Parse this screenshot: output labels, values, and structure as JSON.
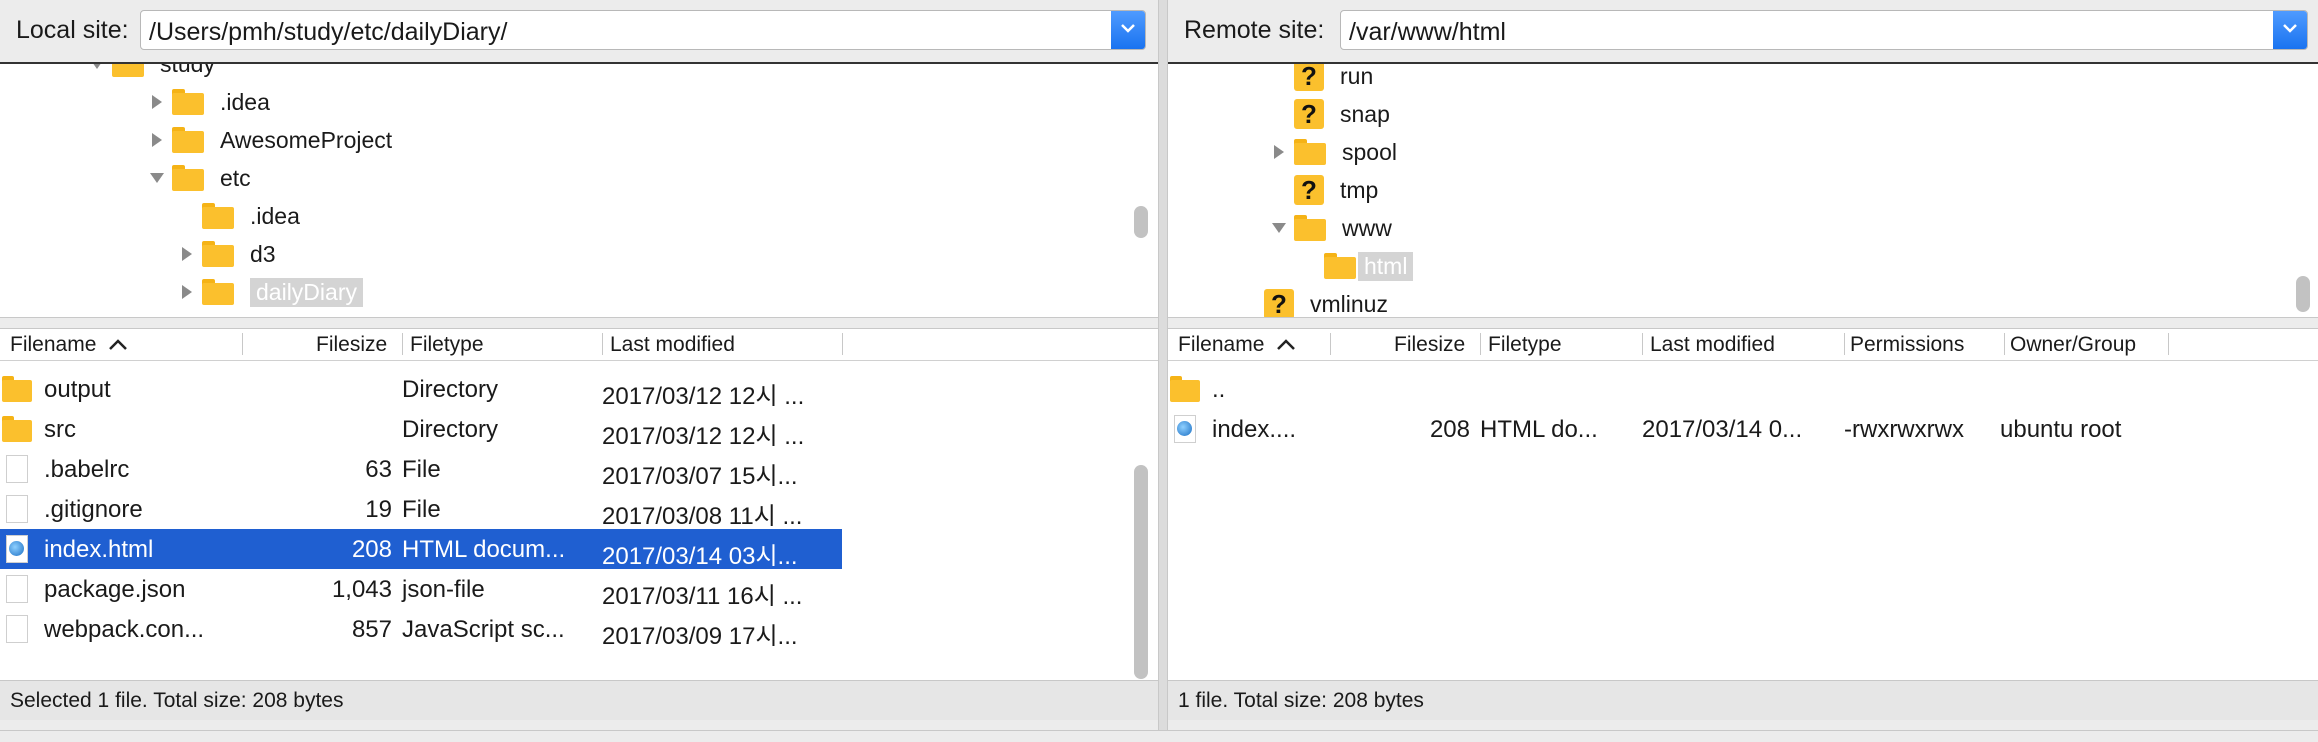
{
  "local": {
    "label": "Local site:",
    "path": "/Users/pmh/study/etc/dailyDiary/",
    "tree": [
      {
        "name": "study"
      },
      {
        "name": ".idea"
      },
      {
        "name": "AwesomeProject"
      },
      {
        "name": "etc"
      },
      {
        "name": ".idea"
      },
      {
        "name": "d3"
      },
      {
        "name": "dailyDiary",
        "selected": true
      }
    ],
    "columns": {
      "filename": "Filename",
      "filesize": "Filesize",
      "filetype": "Filetype",
      "modified": "Last modified"
    },
    "files": [
      {
        "name": "output",
        "size": "",
        "type": "Directory",
        "modified": "2017/03/12 12시 ...",
        "icon": "folder-icon"
      },
      {
        "name": "src",
        "size": "",
        "type": "Directory",
        "modified": "2017/03/12 12시 ...",
        "icon": "folder-icon"
      },
      {
        "name": ".babelrc",
        "size": "63",
        "type": "File",
        "modified": "2017/03/07 15시...",
        "icon": "file-icon"
      },
      {
        "name": ".gitignore",
        "size": "19",
        "type": "File",
        "modified": "2017/03/08 11시 ...",
        "icon": "file-icon"
      },
      {
        "name": "index.html",
        "size": "208",
        "type": "HTML docum...",
        "modified": "2017/03/14 03시...",
        "icon": "html-file-icon",
        "selected": true
      },
      {
        "name": "package.json",
        "size": "1,043",
        "type": "json-file",
        "modified": "2017/03/11 16시 ...",
        "icon": "file-icon"
      },
      {
        "name": "webpack.con...",
        "size": "857",
        "type": "JavaScript sc...",
        "modified": "2017/03/09 17시...",
        "icon": "file-icon"
      }
    ],
    "status": "Selected 1 file. Total size: 208 bytes"
  },
  "remote": {
    "label": "Remote site:",
    "path": "/var/www/html",
    "tree": [
      {
        "name": "run"
      },
      {
        "name": "snap"
      },
      {
        "name": "spool"
      },
      {
        "name": "tmp"
      },
      {
        "name": "www"
      },
      {
        "name": "html",
        "selected": true
      },
      {
        "name": "vmlinuz"
      }
    ],
    "columns": {
      "filename": "Filename",
      "filesize": "Filesize",
      "filetype": "Filetype",
      "modified": "Last modified",
      "permissions": "Permissions",
      "owner": "Owner/Group"
    },
    "files": [
      {
        "name": "..",
        "icon": "folder-icon"
      },
      {
        "name": "index....",
        "size": "208",
        "type": "HTML do...",
        "modified": "2017/03/14 0...",
        "permissions": "-rwxrwxrwx",
        "owner": "ubuntu root",
        "icon": "html-file-icon"
      }
    ],
    "status": "1 file. Total size: 208 bytes"
  }
}
